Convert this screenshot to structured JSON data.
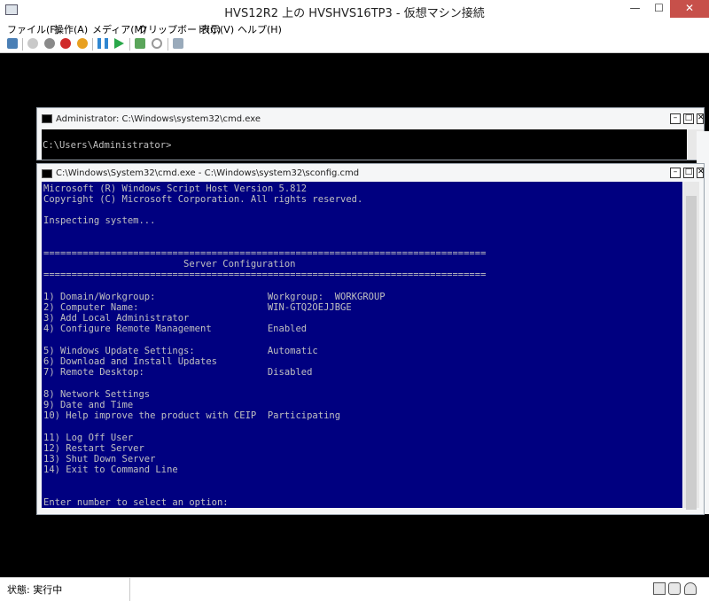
{
  "window": {
    "title": "HVS12R2 上の HVSHVS16TP3 - 仮想マシン接続"
  },
  "menu": [
    "ファイル(F)",
    "操作(A)",
    "メディア(M)",
    "クリップボード(C)",
    "表示(V)",
    "ヘルプ(H)"
  ],
  "toolbar": {
    "icons": [
      "ctrl-alt-del-icon",
      "start-icon",
      "turn-off-icon",
      "shutdown-icon",
      "save-icon",
      "pause-icon",
      "resume-icon",
      "checkpoint-icon",
      "revert-icon",
      "enhanced-session-icon"
    ]
  },
  "cmd_back": {
    "title": "Administrator: C:\\Windows\\system32\\cmd.exe",
    "prompt": "C:\\Users\\Administrator>"
  },
  "cmd_front": {
    "title": "C:\\Windows\\System32\\cmd.exe - C:\\Windows\\system32\\sconfig.cmd",
    "lines": [
      "Microsoft (R) Windows Script Host Version 5.812",
      "Copyright (C) Microsoft Corporation. All rights reserved.",
      "",
      "Inspecting system...",
      "",
      "",
      "===============================================================================",
      "                         Server Configuration",
      "===============================================================================",
      "",
      "1) Domain/Workgroup:                    Workgroup:  WORKGROUP",
      "2) Computer Name:                       WIN-GTQ2OEJJBGE",
      "3) Add Local Administrator",
      "4) Configure Remote Management          Enabled",
      "",
      "5) Windows Update Settings:             Automatic",
      "6) Download and Install Updates",
      "7) Remote Desktop:                      Disabled",
      "",
      "8) Network Settings",
      "9) Date and Time",
      "10) Help improve the product with CEIP  Participating",
      "",
      "11) Log Off User",
      "12) Restart Server",
      "13) Shut Down Server",
      "14) Exit to Command Line",
      "",
      "",
      "Enter number to select an option:"
    ]
  },
  "statusbar": {
    "status": "状態: 実行中"
  },
  "colors": {
    "console_bg": "#000080",
    "console_fg": "#c0c0c0",
    "close": "#c7504a"
  }
}
